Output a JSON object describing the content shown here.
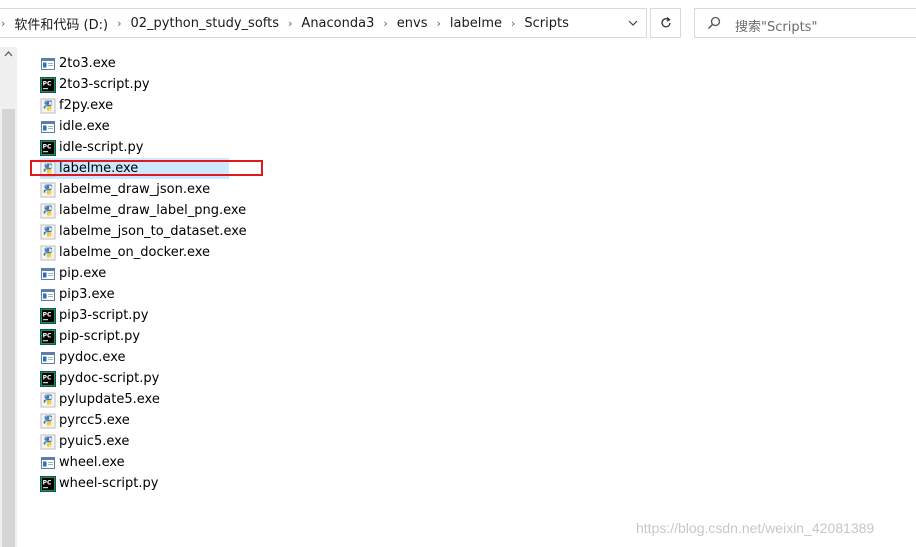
{
  "address_bar": {
    "lead_separator": "›",
    "breadcrumbs": [
      "软件和代码 (D:)",
      "02_python_study_softs",
      "Anaconda3",
      "envs",
      "labelme",
      "Scripts"
    ],
    "separator": "›"
  },
  "search": {
    "placeholder": "搜索\"Scripts\""
  },
  "files": [
    {
      "name": "2to3.exe",
      "icon": "exe-window-icon"
    },
    {
      "name": "2to3-script.py",
      "icon": "pycharm-icon"
    },
    {
      "name": "f2py.exe",
      "icon": "python-exe-icon"
    },
    {
      "name": "idle.exe",
      "icon": "exe-window-icon"
    },
    {
      "name": "idle-script.py",
      "icon": "pycharm-icon"
    },
    {
      "name": "labelme.exe",
      "icon": "python-exe-icon",
      "selected": true
    },
    {
      "name": "labelme_draw_json.exe",
      "icon": "python-exe-icon"
    },
    {
      "name": "labelme_draw_label_png.exe",
      "icon": "python-exe-icon"
    },
    {
      "name": "labelme_json_to_dataset.exe",
      "icon": "python-exe-icon"
    },
    {
      "name": "labelme_on_docker.exe",
      "icon": "python-exe-icon"
    },
    {
      "name": "pip.exe",
      "icon": "exe-window-icon"
    },
    {
      "name": "pip3.exe",
      "icon": "exe-window-icon"
    },
    {
      "name": "pip3-script.py",
      "icon": "pycharm-icon"
    },
    {
      "name": "pip-script.py",
      "icon": "pycharm-icon"
    },
    {
      "name": "pydoc.exe",
      "icon": "exe-window-icon"
    },
    {
      "name": "pydoc-script.py",
      "icon": "pycharm-icon"
    },
    {
      "name": "pylupdate5.exe",
      "icon": "python-exe-icon"
    },
    {
      "name": "pyrcc5.exe",
      "icon": "python-exe-icon"
    },
    {
      "name": "pyuic5.exe",
      "icon": "python-exe-icon"
    },
    {
      "name": "wheel.exe",
      "icon": "exe-window-icon"
    },
    {
      "name": "wheel-script.py",
      "icon": "pycharm-icon"
    }
  ],
  "colors": {
    "selection": "#cce8ff",
    "highlight_box": "#e0191e"
  },
  "watermark": "https://blog.csdn.net/weixin_42081389"
}
